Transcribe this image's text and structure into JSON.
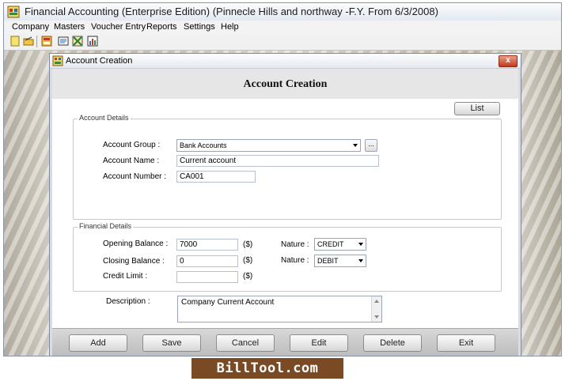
{
  "window": {
    "title": "Financial Accounting (Enterprise Edition) (Pinnecle Hills and northway -F.Y. From 6/3/2008)"
  },
  "menu": [
    "Company",
    "Masters",
    "Voucher Entry",
    "Reports",
    "Settings",
    "Help"
  ],
  "toolbar": {
    "icons": [
      "new-icon",
      "open-icon",
      "calculator-icon",
      "report-icon",
      "settings-icon",
      "chart-icon"
    ]
  },
  "dialog": {
    "title": "Account Creation",
    "close_label": "x",
    "heading": "Account Creation",
    "list_button": "List",
    "account_details": {
      "legend": "Account Details",
      "group_label": "Account Group :",
      "group_value": "Bank Accounts",
      "browse_label": "...",
      "name_label": "Account Name :",
      "name_value": "Current account",
      "number_label": "Account Number :",
      "number_value": "CA001"
    },
    "financial_details": {
      "legend": "Financial Details",
      "opening_label": "Opening Balance :",
      "opening_value": "7000",
      "opening_unit": "($)",
      "closing_label": "Closing Balance :",
      "closing_value": "0",
      "closing_unit": "($)",
      "credit_label": "Credit Limit :",
      "credit_value": "",
      "credit_unit": "($)",
      "nature_label": "Nature :",
      "nature_opening": "CREDIT",
      "nature_closing": "DEBIT"
    },
    "description": {
      "label": "Description :",
      "value": "Company Current Account"
    },
    "buttons": {
      "add": "Add",
      "save": "Save",
      "cancel": "Cancel",
      "edit": "Edit",
      "delete": "Delete",
      "exit": "Exit"
    }
  },
  "footer": {
    "logo_text": "BillTool.com"
  },
  "colors": {
    "close_button": "#c0391e",
    "footer_logo": "#7a4a24"
  }
}
